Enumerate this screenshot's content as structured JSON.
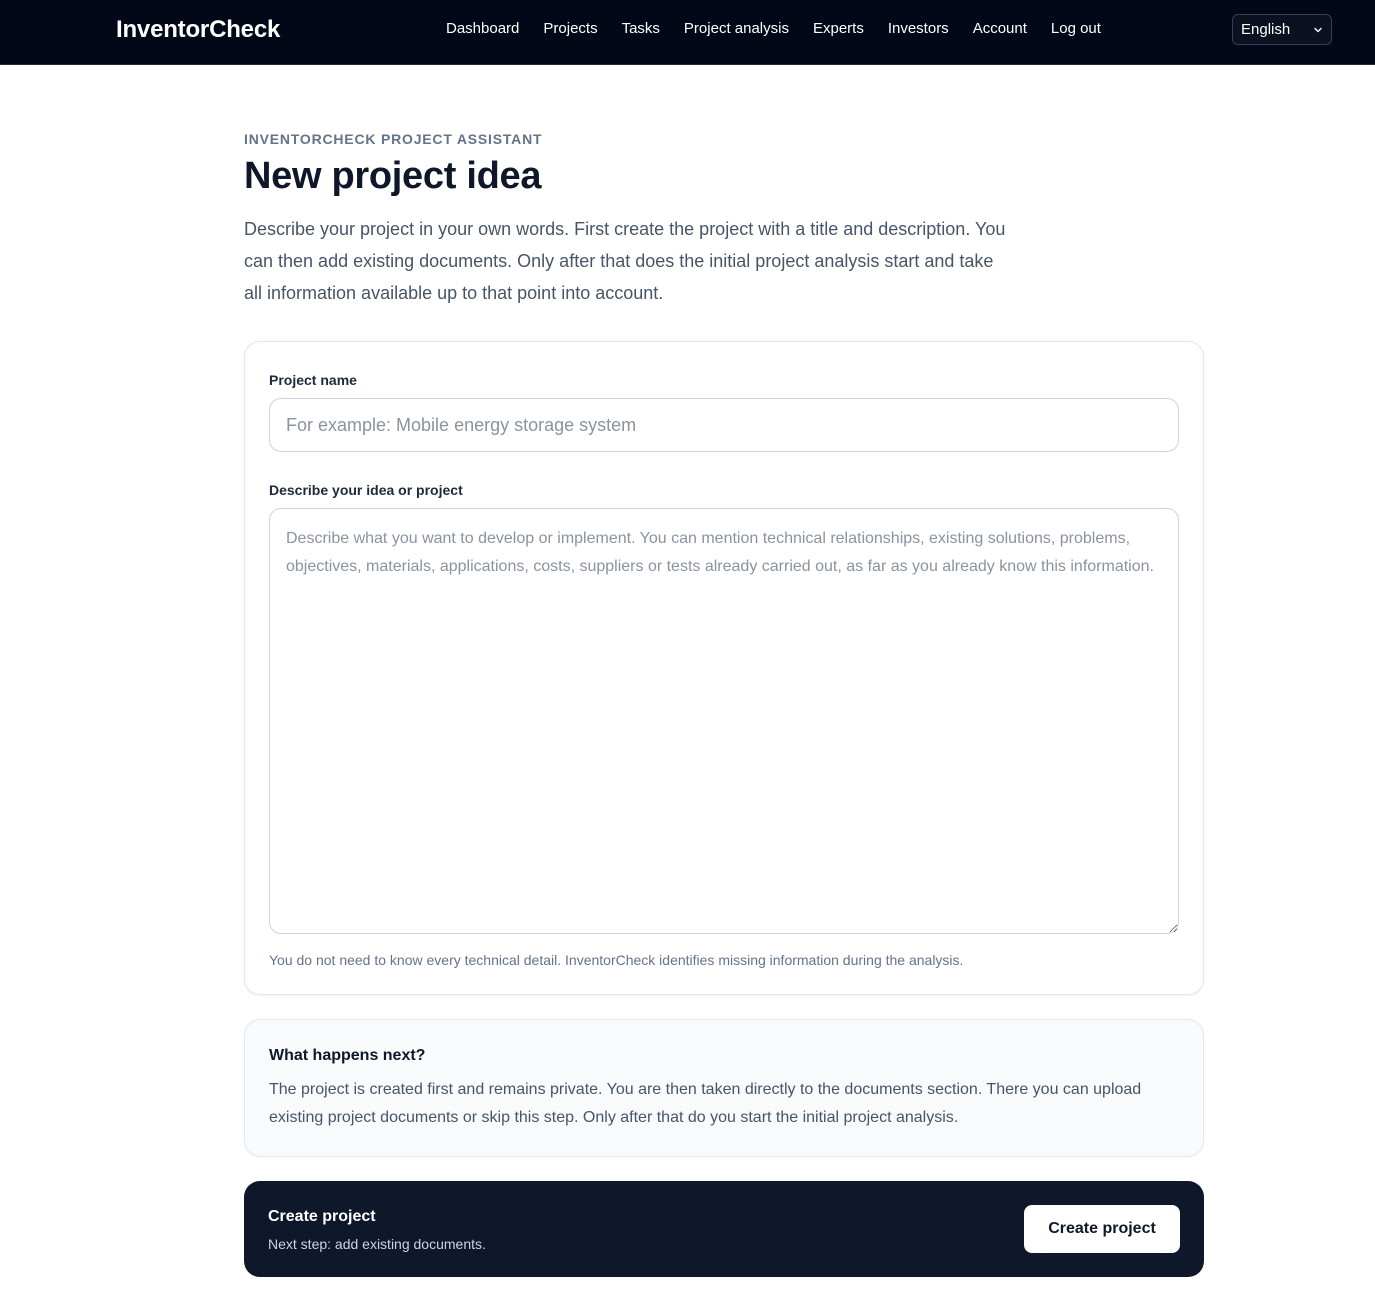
{
  "header": {
    "brand": "InventorCheck",
    "nav": [
      {
        "label": "Dashboard"
      },
      {
        "label": "Projects"
      },
      {
        "label": "Tasks"
      },
      {
        "label": "Project analysis"
      },
      {
        "label": "Experts"
      },
      {
        "label": "Investors"
      },
      {
        "label": "Account"
      },
      {
        "label": "Log out"
      }
    ],
    "language": {
      "selected": "English",
      "icon": "chevron-down-icon"
    }
  },
  "page": {
    "eyebrow": "INVENTORCHECK PROJECT ASSISTANT",
    "title": "New project idea",
    "intro": "Describe your project in your own words. First create the project with a title and description. You can then add existing documents. Only after that does the initial project analysis start and take all information available up to that point into account."
  },
  "form": {
    "name_label": "Project name",
    "name_value": "",
    "name_placeholder": "For example: Mobile energy storage system",
    "description_label": "Describe your idea or project",
    "description_value": "",
    "description_placeholder": "Describe what you want to develop or implement. You can mention technical relationships, existing solutions, problems, objectives, materials, applications, costs, suppliers or tests already carried out, as far as you already know this information.",
    "hint": "You do not need to know every technical detail. InventorCheck identifies missing information during the analysis."
  },
  "next_steps": {
    "title": "What happens next?",
    "body": "The project is created first and remains private. You are then taken directly to the documents section. There you can upload existing project documents or skip this step. Only after that do you start the initial project analysis."
  },
  "cta": {
    "title": "Create project",
    "subtitle": "Next step: add existing documents.",
    "button_label": "Create project"
  },
  "colors": {
    "header_bg": "#020817",
    "cta_bg": "#0f172a",
    "muted_text": "#475569",
    "border": "#e2e8f0"
  }
}
